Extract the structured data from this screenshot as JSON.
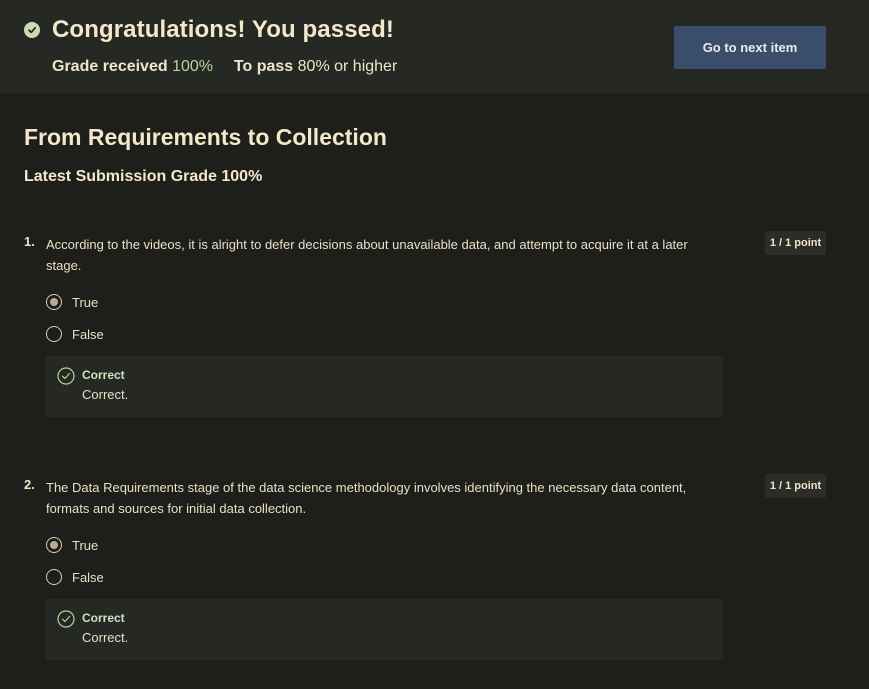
{
  "banner": {
    "title": "Congratulations! You passed!",
    "grade_label": "Grade received",
    "grade_value": "100%",
    "pass_label": "To pass",
    "pass_value": "80%",
    "pass_suffix": "or higher",
    "next_button": "Go to next item"
  },
  "quiz": {
    "title": "From Requirements to Collection",
    "latest_grade": "Latest Submission Grade 100%"
  },
  "questions": [
    {
      "number": "1.",
      "text": "According to the videos, it is alright to defer decisions about unavailable data, and attempt to acquire it at a later stage.",
      "points": "1 / 1 point",
      "options": [
        "True",
        "False"
      ],
      "selected": "True",
      "feedback_title": "Correct",
      "feedback_text": "Correct."
    },
    {
      "number": "2.",
      "text": "The Data Requirements stage of the data science methodology involves identifying the necessary data content, formats and sources for initial data collection.",
      "points": "1 / 1 point",
      "options": [
        "True",
        "False"
      ],
      "selected": "True",
      "feedback_title": "Correct",
      "feedback_text": "Correct."
    }
  ],
  "colors": {
    "background": "#1e1e1b",
    "banner": "#252823",
    "accent_green": "#b9d39a",
    "button": "#3a4d6a"
  }
}
